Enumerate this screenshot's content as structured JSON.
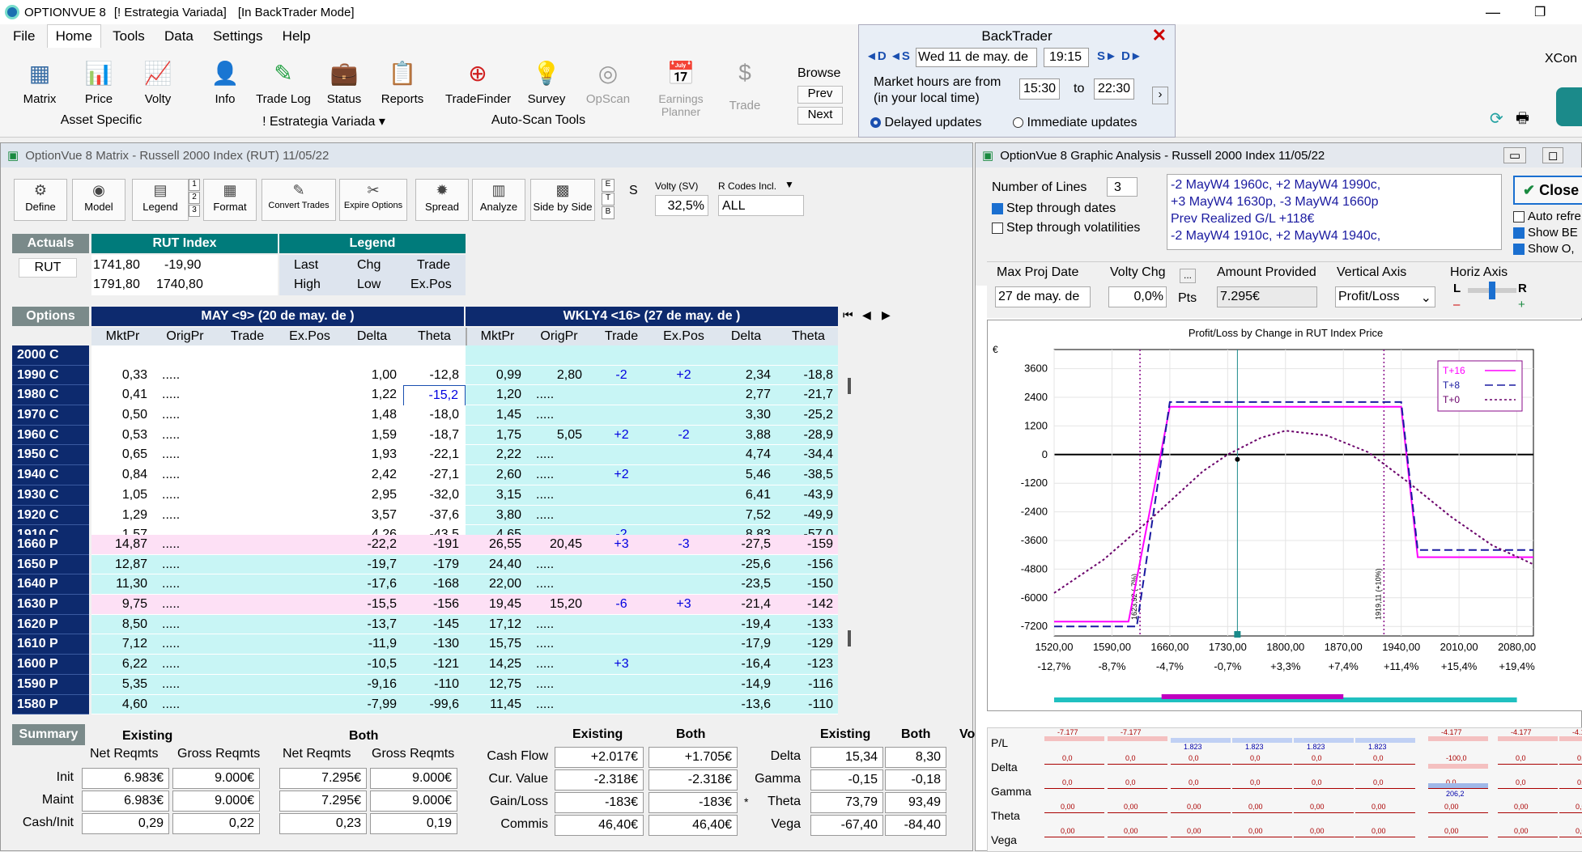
{
  "app": {
    "title": "OPTIONVUE 8",
    "strategy": "[! Estrategia Variada]",
    "mode": "[In BackTrader Mode]"
  },
  "menu": [
    "File",
    "Home",
    "Tools",
    "Data",
    "Settings",
    "Help"
  ],
  "ribbon": {
    "tools": [
      "Matrix",
      "Price",
      "Volty",
      "Info",
      "Trade Log",
      "Status",
      "Reports",
      "TradeFinder",
      "Survey",
      "OpScan",
      "Earnings Planner",
      "Trade"
    ],
    "groups": [
      "Asset Specific",
      "! Estrategia Variada ▾",
      "Auto-Scan Tools"
    ],
    "browse": {
      "label": "Browse",
      "prev": "Prev",
      "next": "Next"
    },
    "xcon": "XCon"
  },
  "backtrader": {
    "title": "BackTrader",
    "date": "Wed 11 de may. de",
    "time": "19:15",
    "hours_label1": "Market hours are from",
    "hours_label2": "(in your local time)",
    "from": "15:30",
    "to_label": "to",
    "to": "22:30",
    "delayed": "Delayed updates",
    "immediate": "Immediate updates"
  },
  "matrix": {
    "title": "OptionVue 8 Matrix - Russell 2000 Index (RUT)  11/05/22",
    "toolbar": [
      "Define",
      "Model",
      "Legend",
      "Format",
      "Convert Trades",
      "Expire Options",
      "Spread",
      "Analyze",
      "Side by Side"
    ],
    "volty_label": "Volty (SV)",
    "volty": "32,5%",
    "rcodes_label": "R Codes Incl.",
    "rcodes": "ALL",
    "s_label": "S",
    "actuals": "Actuals",
    "symbol": "RUT",
    "index_header": "RUT Index",
    "legend_header": "Legend",
    "rut": {
      "last": "1741,80",
      "chg": "-19,90",
      "high": "1791,80",
      "low": "1740,80"
    },
    "legend": [
      "Last",
      "Chg",
      "Trade",
      "High",
      "Low",
      "Ex.Pos"
    ],
    "options_label": "Options",
    "may_header": "MAY <9> (20 de may. de )",
    "wk_header": "WKLY4 <16> (27 de may. de )",
    "cols": [
      "MktPr",
      "OrigPr",
      "Trade",
      "Ex.Pos",
      "Delta",
      "Theta",
      "MktPr",
      "OrigPr",
      "Trade",
      "Ex.Pos",
      "Delta",
      "Theta"
    ],
    "calls": [
      [
        "2000 C",
        "",
        "",
        "",
        "",
        "",
        "",
        "",
        "",
        "",
        "",
        "",
        ""
      ],
      [
        "1990 C",
        "0,33",
        ".....",
        "",
        "",
        "1,00",
        "-12,8",
        "0,99",
        "2,80",
        "-2",
        "+2",
        "2,34",
        "-18,8"
      ],
      [
        "1980 C",
        "0,41",
        ".....",
        "",
        "",
        "1,22",
        "-15,2",
        "1,20",
        ".....",
        "",
        "",
        "2,77",
        "-21,7"
      ],
      [
        "1970 C",
        "0,50",
        ".....",
        "",
        "",
        "1,48",
        "-18,0",
        "1,45",
        ".....",
        "",
        "",
        "3,30",
        "-25,2"
      ],
      [
        "1960 C",
        "0,53",
        ".....",
        "",
        "",
        "1,59",
        "-18,7",
        "1,75",
        "5,05",
        "+2",
        "-2",
        "3,88",
        "-28,9"
      ],
      [
        "1950 C",
        "0,65",
        ".....",
        "",
        "",
        "1,93",
        "-22,1",
        "2,22",
        ".....",
        "",
        "",
        "4,74",
        "-34,4"
      ],
      [
        "1940 C",
        "0,84",
        ".....",
        "",
        "",
        "2,42",
        "-27,1",
        "2,60",
        ".....",
        "+2",
        "",
        "5,46",
        "-38,5"
      ],
      [
        "1930 C",
        "1,05",
        ".....",
        "",
        "",
        "2,95",
        "-32,0",
        "3,15",
        ".....",
        "",
        "",
        "6,41",
        "-43,9"
      ],
      [
        "1920 C",
        "1,29",
        ".....",
        "",
        "",
        "3,57",
        "-37,6",
        "3,80",
        ".....",
        "",
        "",
        "7,52",
        "-49,9"
      ],
      [
        "1910 C",
        "1,57",
        ".....",
        "",
        "",
        "4,26",
        "-43,5",
        "4,65",
        ".....",
        "-2",
        "",
        "8,83",
        "-57,0"
      ]
    ],
    "puts": [
      [
        "1660 P",
        "14,87",
        ".....",
        "",
        "",
        "-22,2",
        "-191",
        "26,55",
        "20,45",
        "+3",
        "-3",
        "-27,5",
        "-159"
      ],
      [
        "1650 P",
        "12,87",
        ".....",
        "",
        "",
        "-19,7",
        "-179",
        "24,40",
        ".....",
        "",
        "",
        "-25,6",
        "-156"
      ],
      [
        "1640 P",
        "11,30",
        ".....",
        "",
        "",
        "-17,6",
        "-168",
        "22,00",
        ".....",
        "",
        "",
        "-23,5",
        "-150"
      ],
      [
        "1630 P",
        "9,75",
        ".....",
        "",
        "",
        "-15,5",
        "-156",
        "19,45",
        "15,20",
        "-6",
        "+3",
        "-21,4",
        "-142"
      ],
      [
        "1620 P",
        "8,50",
        ".....",
        "",
        "",
        "-13,7",
        "-145",
        "17,12",
        ".....",
        "",
        "",
        "-19,4",
        "-133"
      ],
      [
        "1610 P",
        "7,12",
        ".....",
        "",
        "",
        "-11,9",
        "-130",
        "15,75",
        ".....",
        "",
        "",
        "-17,9",
        "-129"
      ],
      [
        "1600 P",
        "6,22",
        ".....",
        "",
        "",
        "-10,5",
        "-121",
        "14,25",
        ".....",
        "+3",
        "",
        "-16,4",
        "-123"
      ],
      [
        "1590 P",
        "5,35",
        ".....",
        "",
        "",
        "-9,16",
        "-110",
        "12,75",
        ".....",
        "",
        "",
        "-14,9",
        "-116"
      ],
      [
        "1580 P",
        "4,60",
        ".....",
        "",
        "",
        "-7,99",
        "-99,6",
        "11,45",
        ".....",
        "",
        "",
        "-13,6",
        "-110"
      ]
    ],
    "summary": {
      "label": "Summary",
      "existing": "Existing",
      "both": "Both",
      "net": "Net Reqmts",
      "gross": "Gross Reqmts",
      "rows": [
        [
          "Init",
          "6.983€",
          "9.000€",
          "7.295€",
          "9.000€"
        ],
        [
          "Maint",
          "6.983€",
          "9.000€",
          "7.295€",
          "9.000€"
        ],
        [
          "Cash/Init",
          "0,29",
          "0,22",
          "0,23",
          "0,19"
        ]
      ],
      "mid": [
        [
          "Cash Flow",
          "+2.017€",
          "+1.705€"
        ],
        [
          "Cur. Value",
          "-2.318€",
          "-2.318€"
        ],
        [
          "Gain/Loss",
          "-183€",
          "-183€"
        ],
        [
          "Commis",
          "46,40€",
          "46,40€"
        ]
      ],
      "greeks": [
        [
          "Delta",
          "15,34",
          "8,30"
        ],
        [
          "Gamma",
          "-0,15",
          "-0,18"
        ],
        [
          "Theta",
          "73,79",
          "93,49"
        ],
        [
          "Vega",
          "-67,40",
          "-84,40"
        ]
      ],
      "vo": "Vo",
      "star": "*"
    }
  },
  "graph": {
    "title": "OptionVue 8 Graphic Analysis - Russell 2000 Index  11/05/22",
    "num_lines_label": "Number of Lines",
    "num_lines": "3",
    "step_dates": "Step through dates",
    "step_vol": "Step through volatilities",
    "desc": [
      "-2 MayW4 1960c, +2 MayW4 1990c,",
      "+3 MayW4 1630p, -3 MayW4 1660p",
      "Prev Realized G/L +118€",
      "-2 MayW4 1910c, +2 MayW4 1940c,"
    ],
    "close": "Close",
    "auto": "Auto refre",
    "show_be": "Show BE",
    "show_o": "Show O,",
    "max_proj_label": "Max Proj Date",
    "max_proj": "27 de may. de",
    "volty_chg_label": "Volty Chg",
    "volty_chg": "0,0%",
    "pts": "Pts",
    "amount_label": "Amount Provided",
    "amount": "7.295€",
    "vaxis_label": "Vertical Axis",
    "vaxis": "Profit/Loss",
    "haxis_label": "Horiz Axis",
    "L": "L",
    "R": "R"
  },
  "chart_data": {
    "type": "line",
    "title": "Profit/Loss by Change in RUT Index Price",
    "ylabel": "€",
    "yticks": [
      3600,
      2400,
      1200,
      0,
      -1200,
      -2400,
      -3600,
      -4800,
      -6000,
      -7200
    ],
    "xticks": [
      "1520,00",
      "1590,00",
      "1660,00",
      "1730,00",
      "1800,00",
      "1870,00",
      "1940,00",
      "2010,00",
      "2080,00"
    ],
    "xpct": [
      "-12,7%",
      "-8,7%",
      "-4,7%",
      "-0,7%",
      "+3,3%",
      "+7,4%",
      "+11,4%",
      "+15,4%",
      "+19,4%"
    ],
    "xlim": [
      1520,
      2100
    ],
    "ylim": [
      -7600,
      4400
    ],
    "vlines": [
      "1623,92 (-7%)",
      "1919,11 (+10%)"
    ],
    "series": [
      {
        "name": "T+16",
        "color": "#ff00ff",
        "x": [
          1520,
          1600,
          1610,
          1660,
          1700,
          1730,
          1800,
          1870,
          1940,
          1960,
          2000,
          2100
        ],
        "y": [
          -7000,
          -7000,
          -7000,
          2000,
          2000,
          2000,
          2000,
          2000,
          2000,
          -4300,
          -4300,
          -4300
        ]
      },
      {
        "name": "T+8",
        "color": "#1a1aa0",
        "x": [
          1520,
          1600,
          1620,
          1660,
          1700,
          1730,
          1800,
          1870,
          1940,
          1960,
          2000,
          2100
        ],
        "y": [
          -7200,
          -7200,
          -7200,
          2200,
          2200,
          2200,
          2200,
          2200,
          2200,
          -4000,
          -4000,
          -4000
        ]
      },
      {
        "name": "T+0",
        "color": "#6a006a",
        "x": [
          1520,
          1580,
          1640,
          1700,
          1730,
          1770,
          1800,
          1850,
          1900,
          1950,
          2000,
          2050,
          2100
        ],
        "y": [
          -5800,
          -4400,
          -2600,
          -700,
          0,
          700,
          1000,
          800,
          100,
          -1200,
          -2600,
          -3800,
          -4600
        ]
      }
    ]
  },
  "greek_strip": {
    "labels": [
      "P/L",
      "Delta",
      "Gamma",
      "Theta",
      "Vega"
    ],
    "pl": [
      "-7.177",
      "-7.177",
      "1.823",
      "1.823",
      "1.823",
      "1.823",
      "-4.177",
      "-4.177",
      "-4.177"
    ],
    "delta": "0,0",
    "delta_neg": "-100,0",
    "gamma": "0,0",
    "gamma_pos": "206,2",
    "theta": "0,00",
    "vega": "0,00"
  }
}
